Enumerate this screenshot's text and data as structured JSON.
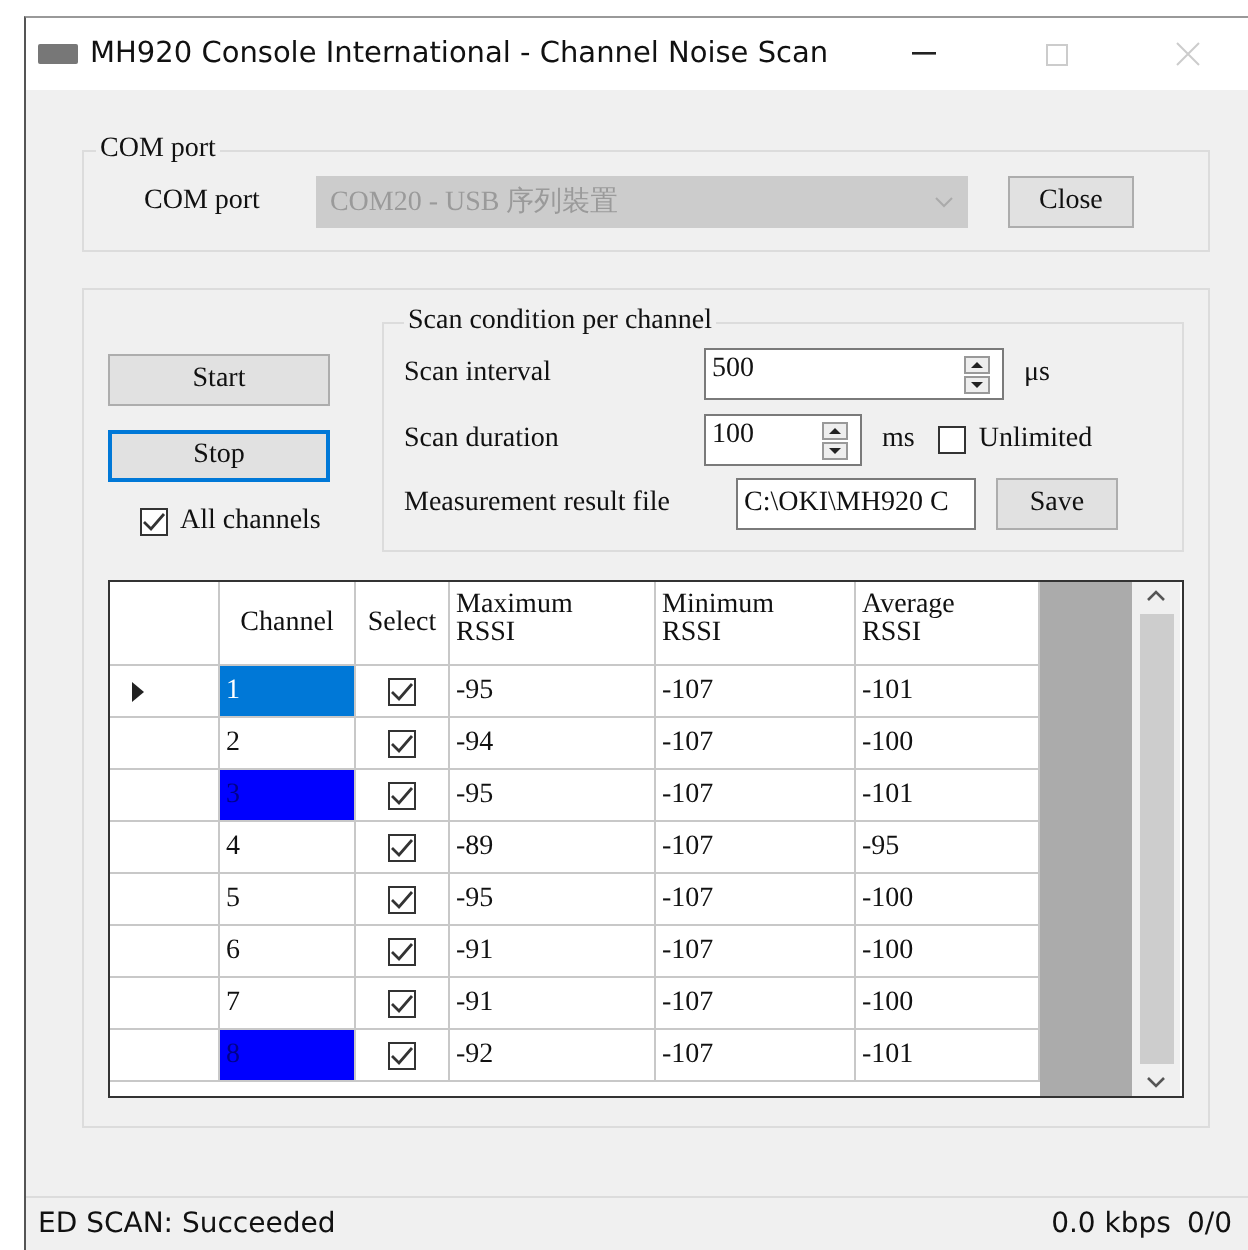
{
  "window": {
    "title": "MH920 Console International - Channel Noise Scan"
  },
  "com_port": {
    "group_title": "COM port",
    "label": "COM port",
    "value": "COM20 - USB 序列裝置",
    "disabled": true,
    "button": "Close"
  },
  "buttons": [
    {
      "label": "Start",
      "focused": false
    },
    {
      "label": "Stop",
      "focused": true
    }
  ],
  "all_channels": {
    "label": "All channels",
    "checked": true
  },
  "condition": {
    "title": "Scan condition per channel",
    "interval": {
      "label": "Scan interval",
      "value": "500",
      "unit": "μs"
    },
    "duration": {
      "label": "Scan duration",
      "value": "100",
      "unit": "ms"
    },
    "unlimited": {
      "label": "Unlimited",
      "checked": false
    },
    "result_file": {
      "label": "Measurement result file",
      "value": "C:\\OKI\\MH920 C",
      "button": "Save"
    }
  },
  "table": {
    "columns": [
      "Channel",
      "Select",
      "Maximum RSSI",
      "Minimum RSSI",
      "Average RSSI"
    ],
    "rows": [
      {
        "channel": "1",
        "selected": true,
        "color": "#0078d7",
        "checked": true,
        "max": "-95",
        "min": "-107",
        "avg": "-101"
      },
      {
        "channel": "2",
        "selected": false,
        "color": "#ffffff",
        "checked": true,
        "max": "-94",
        "min": "-107",
        "avg": "-100"
      },
      {
        "channel": "3",
        "selected": false,
        "color": "#0000ff",
        "checked": true,
        "max": "-95",
        "min": "-107",
        "avg": "-101"
      },
      {
        "channel": "4",
        "selected": false,
        "color": "#ffffff",
        "checked": true,
        "max": "-89",
        "min": "-107",
        "avg": "-95"
      },
      {
        "channel": "5",
        "selected": false,
        "color": "#ffffff",
        "checked": true,
        "max": "-95",
        "min": "-107",
        "avg": "-100"
      },
      {
        "channel": "6",
        "selected": false,
        "color": "#ffffff",
        "checked": true,
        "max": "-91",
        "min": "-107",
        "avg": "-100"
      },
      {
        "channel": "7",
        "selected": false,
        "color": "#ffffff",
        "checked": true,
        "max": "-91",
        "min": "-107",
        "avg": "-100"
      },
      {
        "channel": "8",
        "selected": false,
        "color": "#0000ff",
        "checked": true,
        "max": "-92",
        "min": "-107",
        "avg": "-101"
      }
    ]
  },
  "status_bar": {
    "message": "ED SCAN: Succeeded",
    "rate": "0.0 kbps",
    "count": "0/0"
  }
}
